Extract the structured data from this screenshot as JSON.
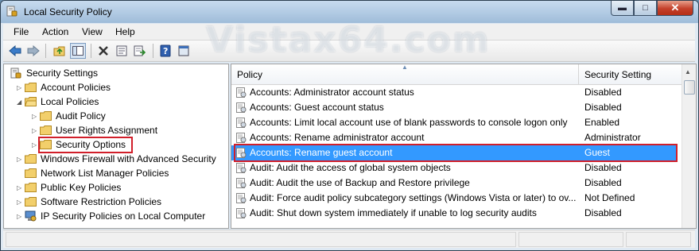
{
  "window": {
    "title": "Local Security Policy",
    "watermark": "Vistax64.com"
  },
  "menu": {
    "file": "File",
    "action": "Action",
    "view": "View",
    "help": "Help"
  },
  "toolbar": {
    "buttons": [
      "back-icon",
      "forward-icon",
      "up-folder-icon",
      "show-hide-tree-icon",
      "delete-icon",
      "properties-icon",
      "export-list-icon",
      "help-icon",
      "console-icon"
    ]
  },
  "tree": {
    "root": "Security Settings",
    "items": [
      {
        "label": "Account Policies",
        "level": 1,
        "expanded": false
      },
      {
        "label": "Local Policies",
        "level": 1,
        "expanded": true
      },
      {
        "label": "Audit Policy",
        "level": 2,
        "expanded": false
      },
      {
        "label": "User Rights Assignment",
        "level": 2,
        "expanded": false
      },
      {
        "label": "Security Options",
        "level": 2,
        "expanded": false,
        "highlighted": true
      },
      {
        "label": "Windows Firewall with Advanced Security",
        "level": 1,
        "expanded": false
      },
      {
        "label": "Network List Manager Policies",
        "level": 1
      },
      {
        "label": "Public Key Policies",
        "level": 1,
        "expanded": false
      },
      {
        "label": "Software Restriction Policies",
        "level": 1,
        "expanded": false
      },
      {
        "label": "IP Security Policies on Local Computer",
        "level": 1,
        "expanded": false
      }
    ]
  },
  "list": {
    "columns": {
      "policy": "Policy",
      "setting": "Security Setting"
    },
    "rows": [
      {
        "policy": "Accounts: Administrator account status",
        "setting": "Disabled"
      },
      {
        "policy": "Accounts: Guest account status",
        "setting": "Disabled"
      },
      {
        "policy": "Accounts: Limit local account use of blank passwords to console logon only",
        "setting": "Enabled"
      },
      {
        "policy": "Accounts: Rename administrator account",
        "setting": "Administrator"
      },
      {
        "policy": "Accounts: Rename guest account",
        "setting": "Guest",
        "selected": true
      },
      {
        "policy": "Audit: Audit the access of global system objects",
        "setting": "Disabled"
      },
      {
        "policy": "Audit: Audit the use of Backup and Restore privilege",
        "setting": "Disabled"
      },
      {
        "policy": "Audit: Force audit policy subcategory settings (Windows Vista or later) to ov...",
        "setting": "Not Defined"
      },
      {
        "policy": "Audit: Shut down system immediately if unable to log security audits",
        "setting": "Disabled"
      }
    ]
  },
  "colors": {
    "selection": "#3399ff",
    "highlight_box": "#d11f2a"
  }
}
